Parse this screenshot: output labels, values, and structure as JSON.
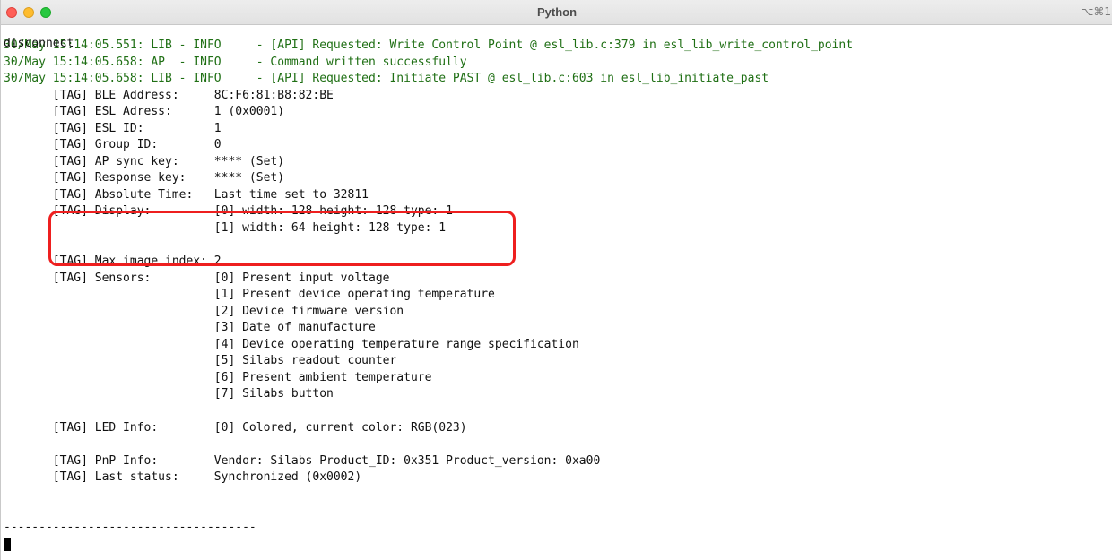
{
  "window": {
    "title": "Python",
    "shortcut": "⌥⌘1"
  },
  "terminal": {
    "first_line": "disconnect",
    "log_lines": [
      "30/May 15:14:05.551: LIB - INFO     - [API] Requested: Write Control Point @ esl_lib.c:379 in esl_lib_write_control_point",
      "30/May 15:14:05.658: AP  - INFO     - Command written successfully",
      "30/May 15:14:05.658: LIB - INFO     - [API] Requested: Initiate PAST @ esl_lib.c:603 in esl_lib_initiate_past"
    ],
    "tag_lines": [
      "       [TAG] BLE Address:     8C:F6:81:B8:82:BE",
      "       [TAG] ESL Adress:      1 (0x0001)",
      "       [TAG] ESL ID:          1",
      "       [TAG] Group ID:        0",
      "       [TAG] AP sync key:     **** (Set)",
      "       [TAG] Response key:    **** (Set)",
      "       [TAG] Absolute Time:   Last time set to 32811",
      "       [TAG] Display:         [0] width: 128 height: 128 type: 1",
      "                              [1] width: 64 height: 128 type: 1",
      "",
      "       [TAG] Max image index: 2",
      "       [TAG] Sensors:         [0] Present input voltage",
      "                              [1] Present device operating temperature",
      "                              [2] Device firmware version",
      "                              [3] Date of manufacture",
      "                              [4] Device operating temperature range specification",
      "                              [5] Silabs readout counter",
      "                              [6] Present ambient temperature",
      "                              [7] Silabs button",
      "",
      "       [TAG] LED Info:        [0] Colored, current color: RGB(023)",
      "",
      "       [TAG] PnP Info:        Vendor: Silabs Product_ID: 0x351 Product_version: 0xa00",
      "       [TAG] Last status:     Synchronized (0x0002)",
      "",
      "",
      "------------------------------------"
    ]
  },
  "colors": {
    "log_text": "#1f6f14",
    "highlight_border": "#ee1f1f",
    "text": "#111111"
  }
}
